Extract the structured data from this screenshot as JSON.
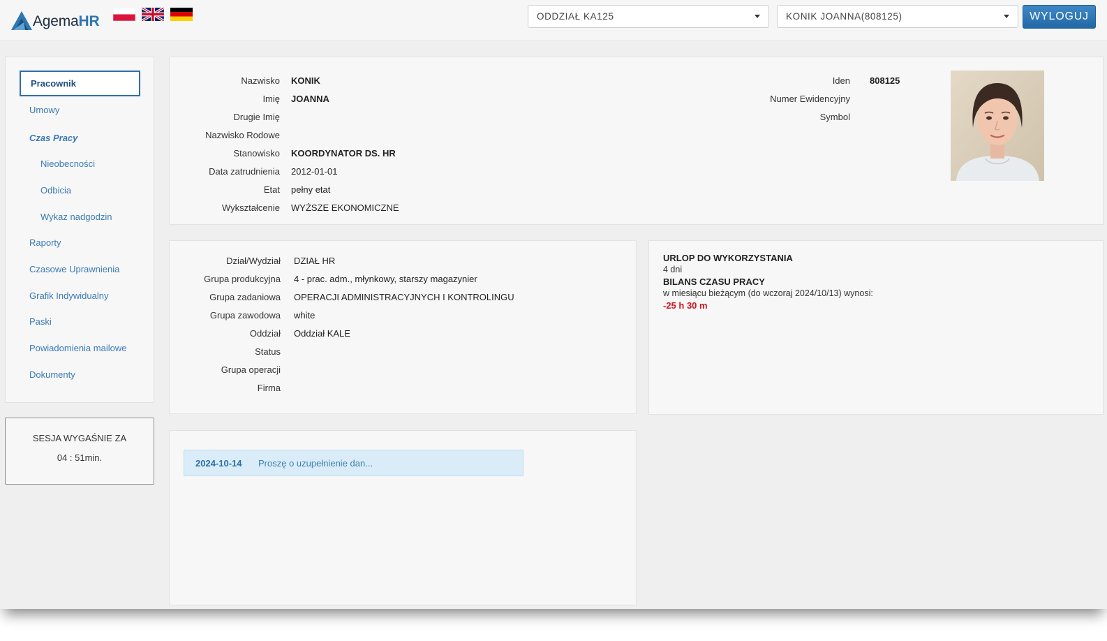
{
  "header": {
    "brand_plain": "Agema",
    "brand_bold": "HR",
    "department_select": {
      "value": "ODDZIAŁ KA125"
    },
    "employee_select": {
      "value": "KONIK JOANNA(808125)"
    },
    "logout_label": "WYLOGUJ",
    "flags": [
      "flag-poland-icon",
      "flag-uk-icon",
      "flag-germany-icon"
    ]
  },
  "sidebar": {
    "items": [
      {
        "label": "Pracownik"
      },
      {
        "label": "Umowy"
      },
      {
        "label": "Czas Pracy"
      },
      {
        "label": "Nieobecności"
      },
      {
        "label": "Odbicia"
      },
      {
        "label": "Wykaz nadgodzin"
      },
      {
        "label": "Raporty"
      },
      {
        "label": "Czasowe Uprawnienia"
      },
      {
        "label": "Grafik Indywidualny"
      },
      {
        "label": "Paski"
      },
      {
        "label": "Powiadomienia mailowe"
      },
      {
        "label": "Dokumenty"
      }
    ]
  },
  "session": {
    "label": "SESJA WYGAŚNIE ZA",
    "time": "04 : 51min."
  },
  "personal": {
    "fields": [
      {
        "label": "Nazwisko",
        "value": "KONIK"
      },
      {
        "label": "Imię",
        "value": "JOANNA"
      },
      {
        "label": "Drugie Imię",
        "value": ""
      },
      {
        "label": "Nazwisko Rodowe",
        "value": ""
      },
      {
        "label": "Stanowisko",
        "value": "KOORDYNATOR DS. HR"
      },
      {
        "label": "Data zatrudnienia",
        "value": "2012-01-01"
      },
      {
        "label": "Etat",
        "value": "pełny etat"
      },
      {
        "label": "Wykształcenie",
        "value": "WYŻSZE EKONOMICZNE"
      }
    ],
    "right_fields": [
      {
        "label": "Iden",
        "value": "808125"
      },
      {
        "label": "Numer Ewidencyjny",
        "value": ""
      },
      {
        "label": "Symbol",
        "value": ""
      }
    ]
  },
  "organization": {
    "fields": [
      {
        "label": "Dział/Wydział",
        "value": "DZIAŁ HR"
      },
      {
        "label": "Grupa produkcyjna",
        "value": "4 - prac. adm., młynkowy, starszy magazynier"
      },
      {
        "label": "Grupa zadaniowa",
        "value": "OPERACJI ADMINISTRACYJNYCH I KONTROLINGU"
      },
      {
        "label": "Grupa zawodowa",
        "value": "white"
      },
      {
        "label": "Oddział",
        "value": "Oddział KALE"
      },
      {
        "label": "Status",
        "value": ""
      },
      {
        "label": "Grupa operacji",
        "value": ""
      },
      {
        "label": "Firma",
        "value": ""
      }
    ]
  },
  "balance": {
    "leave_title": "URLOP DO WYKORZYSTANIA",
    "leave_value": "4 dni",
    "worktime_title": "BILANS CZASU PRACY",
    "worktime_text": "w miesiącu bieżącym (do wczoraj 2024/10/13) wynosi:",
    "worktime_value": "-25 h 30 m",
    "negative_color": "#d0151f"
  },
  "messages": [
    {
      "date": "2024-10-14",
      "text": "Proszę o uzupełnienie dan..."
    }
  ],
  "colors": {
    "accent": "#2f77b1",
    "link": "#3a7ab5",
    "message_bg": "#d9ecf7"
  }
}
